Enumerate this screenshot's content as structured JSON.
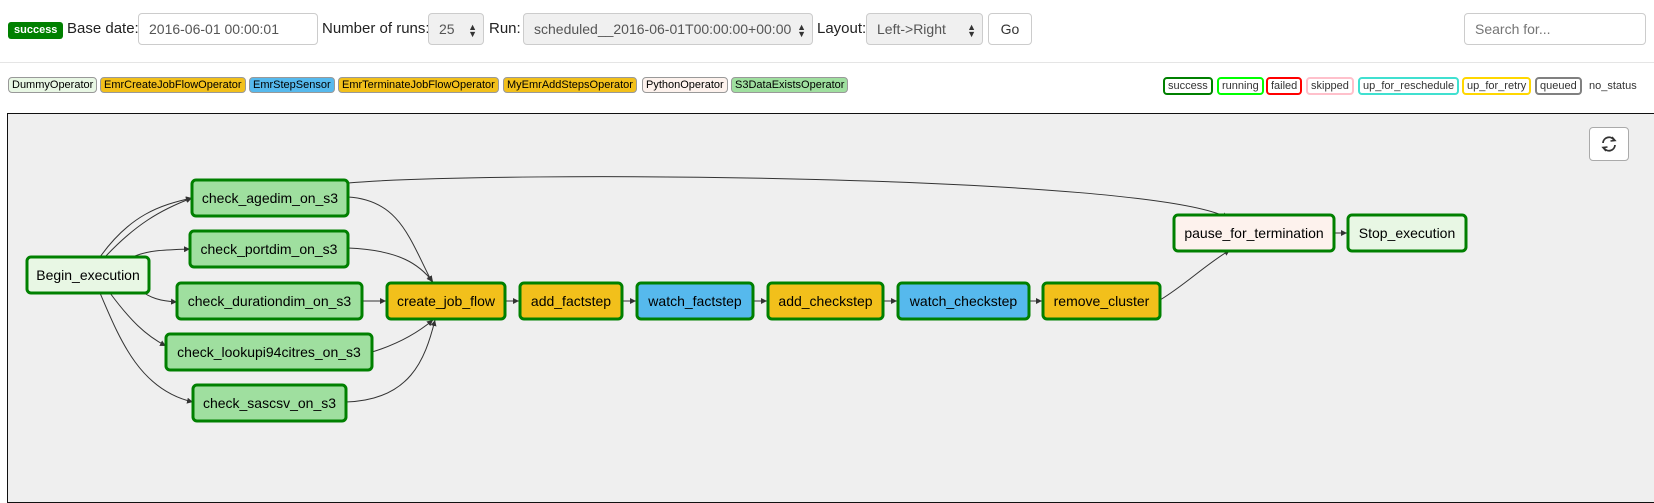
{
  "toolbar": {
    "status_badge": "success",
    "base_date_label": "Base date:",
    "base_date_value": "2016-06-01 00:00:01",
    "num_runs_label": "Number of runs:",
    "num_runs_value": "25",
    "run_label": "Run:",
    "run_value": "scheduled__2016-06-01T00:00:00+00:00",
    "layout_label": "Layout:",
    "layout_value": "Left->Right",
    "go_label": "Go",
    "search_placeholder": "Search for..."
  },
  "operator_legend": [
    {
      "label": "DummyOperator",
      "color": "#e8f7e4"
    },
    {
      "label": "EmrCreateJobFlowOperator",
      "color": "#f2c01b"
    },
    {
      "label": "EmrStepSensor",
      "color": "#56b9ed"
    },
    {
      "label": "EmrTerminateJobFlowOperator",
      "color": "#f2c01b"
    },
    {
      "label": "MyEmrAddStepsOperator",
      "color": "#f2c01b"
    },
    {
      "label": "PythonOperator",
      "color": "#fdf2ed"
    },
    {
      "label": "S3DataExistsOperator",
      "color": "#9fdf9f"
    }
  ],
  "state_legend": [
    {
      "label": "success",
      "color": "#008000"
    },
    {
      "label": "running",
      "color": "#00ff00"
    },
    {
      "label": "failed",
      "color": "#ff0000"
    },
    {
      "label": "skipped",
      "color": "#ffc0cb"
    },
    {
      "label": "up_for_reschedule",
      "color": "#40e0d0"
    },
    {
      "label": "up_for_retry",
      "color": "#ffd700"
    },
    {
      "label": "queued",
      "color": "#808080"
    },
    {
      "label": "no_status",
      "color": "none"
    }
  ],
  "graph": {
    "refresh_icon": "refresh-icon",
    "nodes": {
      "begin": {
        "label": "Begin_execution",
        "color": "#e8f7e4"
      },
      "agedim": {
        "label": "check_agedim_on_s3",
        "color": "#9fdf9f"
      },
      "portdim": {
        "label": "check_portdim_on_s3",
        "color": "#9fdf9f"
      },
      "durationdim": {
        "label": "check_durationdim_on_s3",
        "color": "#9fdf9f"
      },
      "lookup": {
        "label": "check_lookupi94citres_on_s3",
        "color": "#9fdf9f"
      },
      "sascsv": {
        "label": "check_sascsv_on_s3",
        "color": "#9fdf9f"
      },
      "create": {
        "label": "create_job_flow",
        "color": "#f2c01b"
      },
      "addfact": {
        "label": "add_factstep",
        "color": "#f2c01b"
      },
      "watchfact": {
        "label": "watch_factstep",
        "color": "#56b9ed"
      },
      "addcheck": {
        "label": "add_checkstep",
        "color": "#f2c01b"
      },
      "watchcheck": {
        "label": "watch_checkstep",
        "color": "#56b9ed"
      },
      "remove": {
        "label": "remove_cluster",
        "color": "#f2c01b"
      },
      "pause": {
        "label": "pause_for_termination",
        "color": "#fdf2ed"
      },
      "stop": {
        "label": "Stop_execution",
        "color": "#e8f7e4"
      }
    },
    "border_color": "#008000"
  }
}
